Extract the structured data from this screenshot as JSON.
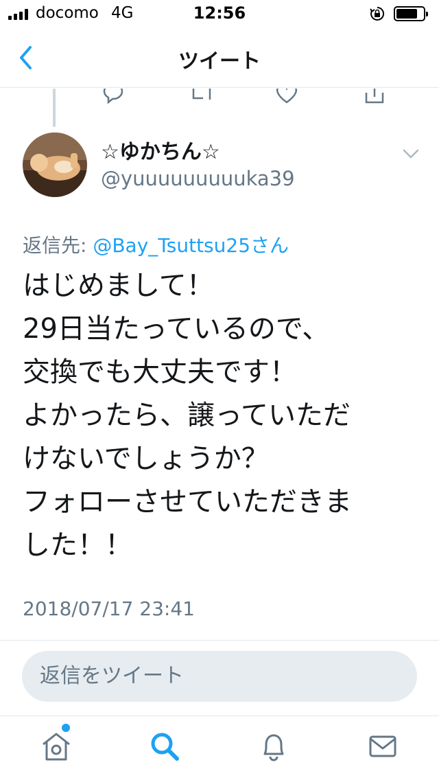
{
  "status_bar": {
    "carrier": "docomo",
    "network": "4G",
    "time": "12:56",
    "battery_level": 0.7
  },
  "nav": {
    "title": "ツイート"
  },
  "tweet": {
    "display_name": "☆ゆかちん☆",
    "username": "@yuuuuuuuuuka39",
    "reply_prefix": "返信先: ",
    "reply_mention": "@Bay_Tsuttsu25さん",
    "text": "はじめまして！\n29日当たっているので、\n交換でも大丈夫です！\nよかったら、譲っていただ\nけないでしょうか？\nフォローさせていただきま\nした！！",
    "timestamp": "2018/07/17 23:41"
  },
  "reply_box": {
    "placeholder": "返信をツイート"
  },
  "tab_bar": {
    "items": [
      "home-icon",
      "search-icon",
      "notifications-icon",
      "messages-icon"
    ],
    "active": "search-icon",
    "accent": "#1da1f2",
    "inactive": "#657786"
  },
  "colors": {
    "accent": "#1da1f2",
    "secondary_text": "#657786",
    "primary_text": "#14171a",
    "divider": "#e1e8ed"
  }
}
